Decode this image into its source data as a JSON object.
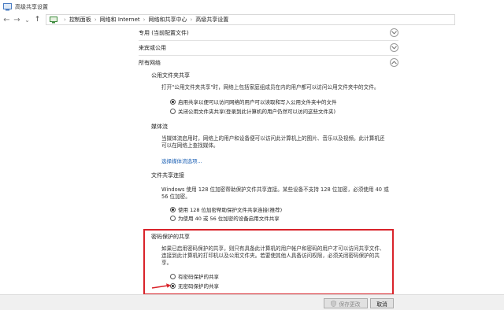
{
  "window": {
    "title": "高级共享设置"
  },
  "nav": {
    "back": "←",
    "forward": "→",
    "dropdown": "⌄",
    "up": "↑",
    "breadcrumbs": [
      "控制面板",
      "网络和 Internet",
      "网络和共享中心",
      "高级共享设置"
    ]
  },
  "profiles": [
    {
      "label": "专用 (当前配置文件)"
    },
    {
      "label": "来宾或公用"
    },
    {
      "label": "所有网络"
    }
  ],
  "public_folder": {
    "title": "公用文件夹共享",
    "desc": "打开\"公用文件夹共享\"时，网络上包括家庭组成员在内的用户都可以访问公用文件夹中的文件。",
    "options": [
      {
        "label": "启用共享以便可以访问网络的用户可以读取和写入公用文件夹中的文件",
        "selected": true
      },
      {
        "label": "关闭公用文件夹共享(登录到此计算机的用户仍然可以访问这些文件夹)",
        "selected": false
      }
    ]
  },
  "media": {
    "title": "媒体流",
    "desc_line1": "当媒体流启用时，网络上的用户和设备便可以访问此计算机上的图片、音乐以及视频。此计算机还",
    "desc_line2": "可以在网络上查找媒体。",
    "link": "选择媒体流选项..."
  },
  "file_sharing": {
    "title": "文件共享连接",
    "desc_line1": "Windows 使用 128 位加密帮助保护文件共享连接。某些设备不支持 128 位加密，必须使用 40 或",
    "desc_line2": "56 位加密。",
    "options": [
      {
        "label": "使用 128 位加密帮助保护文件共享连接(推荐)",
        "selected": true
      },
      {
        "label": "为使用 40 或 56 位加密的设备启用文件共享",
        "selected": false
      }
    ]
  },
  "password": {
    "title": "密码保护的共享",
    "desc_line1": "如果已启用密码保护的共享，则只有具备此计算机的用户帐户和密码的用户才可以访问共享文件、",
    "desc_line2": "连接到此计算机的打印机以及公用文件夹。若要使其他人具备访问权限，必须关闭密码保护的共",
    "desc_line3": "享。",
    "options": [
      {
        "label": "有密码保护的共享",
        "selected": false
      },
      {
        "label": "无密码保护的共享",
        "selected": true
      }
    ]
  },
  "buttons": {
    "save": "保存更改",
    "cancel": "取消"
  },
  "colors": {
    "highlight_box": "#d9232a",
    "link": "#1a5fb4"
  }
}
